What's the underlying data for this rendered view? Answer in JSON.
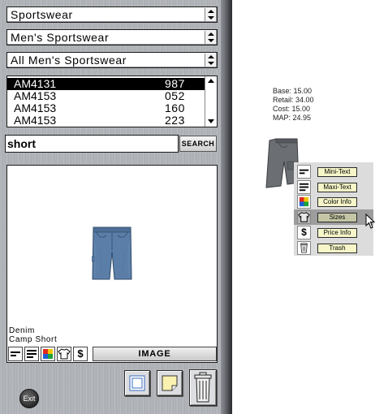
{
  "filters": {
    "department": "Sportswear",
    "category": "Men's Sportswear",
    "subcategory": "All Men's Sportswear"
  },
  "style_list": {
    "rows": [
      {
        "code": "AM4131",
        "num": "987",
        "selected": true
      },
      {
        "code": "AM4153",
        "num": "052",
        "selected": false
      },
      {
        "code": "AM4153",
        "num": "160",
        "selected": false
      },
      {
        "code": "AM4153",
        "num": "223",
        "selected": false
      }
    ]
  },
  "search": {
    "value": "short",
    "button_label": "SEARCH"
  },
  "product": {
    "name_line1": "Denim",
    "name_line2": "Camp Short"
  },
  "image_toolbar": {
    "icons": [
      "mini-text-icon",
      "maxi-text-icon",
      "color-info-icon",
      "sizes-icon",
      "price-icon"
    ],
    "price_symbol": "$",
    "image_label": "IMAGE"
  },
  "exit_label": "Exit",
  "hover_card": {
    "base": "Base: 15.00",
    "retail": "Retail: 34.00",
    "cost": "Cost: 15.00",
    "map": "MAP: 24.95"
  },
  "context_menu": {
    "items": [
      {
        "label": "Mini-Text",
        "icon": "mini-text-icon"
      },
      {
        "label": "Maxi-Text",
        "icon": "maxi-text-icon"
      },
      {
        "label": "Color Info",
        "icon": "color-info-icon"
      },
      {
        "label": "Sizes",
        "icon": "shirt-icon"
      },
      {
        "label": "Price Info",
        "icon": "dollar-icon"
      },
      {
        "label": "Trash",
        "icon": "trash-icon"
      }
    ],
    "active_index": 3,
    "price_symbol": "$"
  },
  "colors": {
    "denim": "#5b7ea8",
    "gray_shorts": "#6b6e72",
    "highlight_row": "#9d9d9d",
    "menu_label_bg": "#f6f6c9"
  }
}
